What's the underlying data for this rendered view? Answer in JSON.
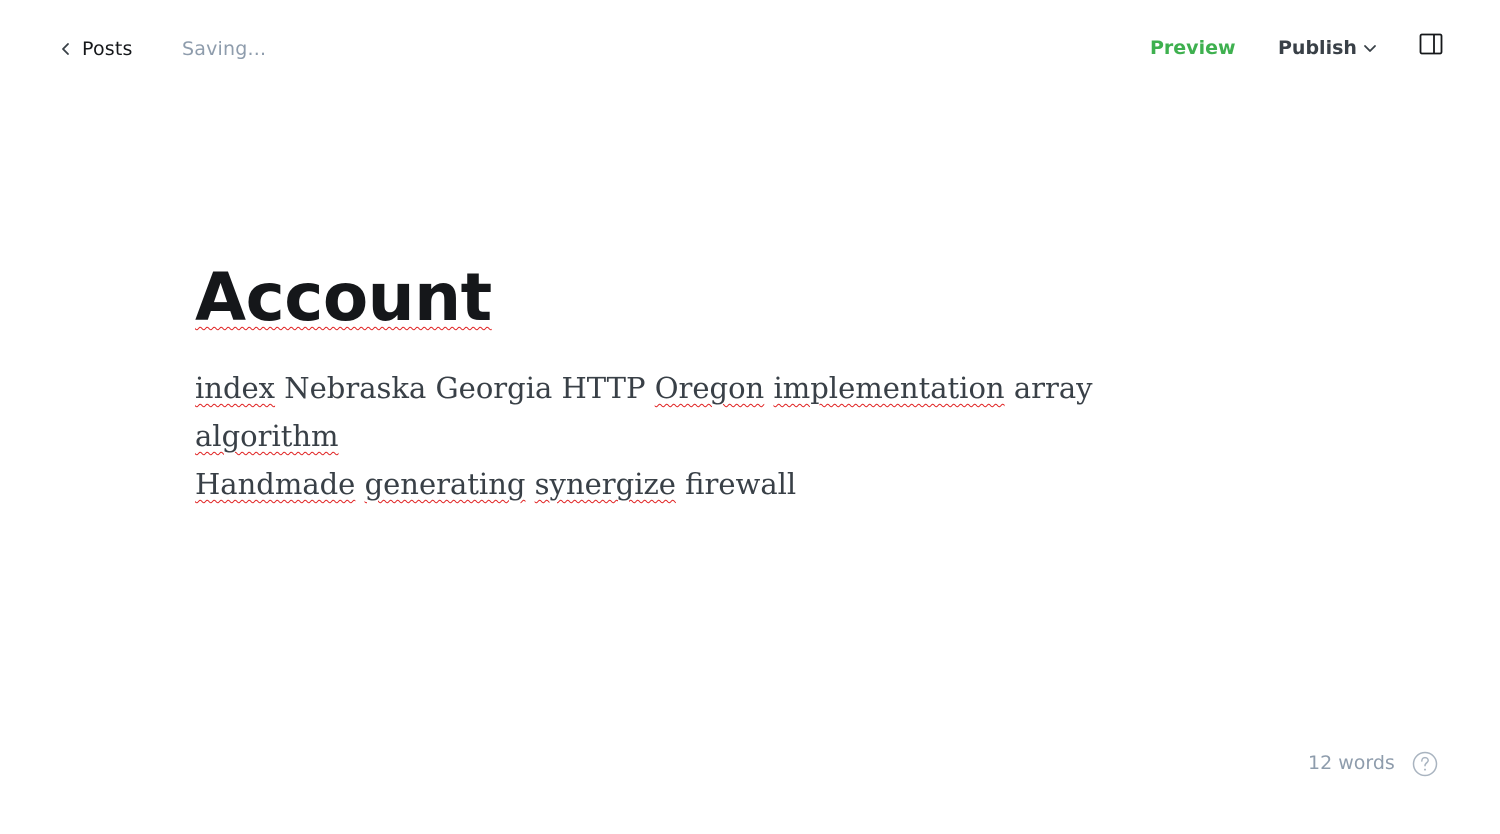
{
  "topbar": {
    "back_label": "Posts",
    "status": "Saving...",
    "preview_label": "Preview",
    "publish_label": "Publish"
  },
  "icons": {
    "back": "chevron-left-icon",
    "publish_dropdown": "chevron-down-icon",
    "sidebar": "sidebar-toggle-icon",
    "help": "help-circle-icon"
  },
  "colors": {
    "accent_green": "#3eb04f",
    "muted_text": "#8e9cac",
    "spellcheck": "#e02020"
  },
  "post": {
    "title": "Account",
    "words": [
      "index",
      "Nebraska",
      "Georgia",
      "HTTP",
      "Oregon",
      "implementation",
      "array",
      "algorithm",
      "Handmade",
      "generating",
      "synergize",
      "firewall"
    ]
  },
  "footer": {
    "word_count": "12 words"
  }
}
